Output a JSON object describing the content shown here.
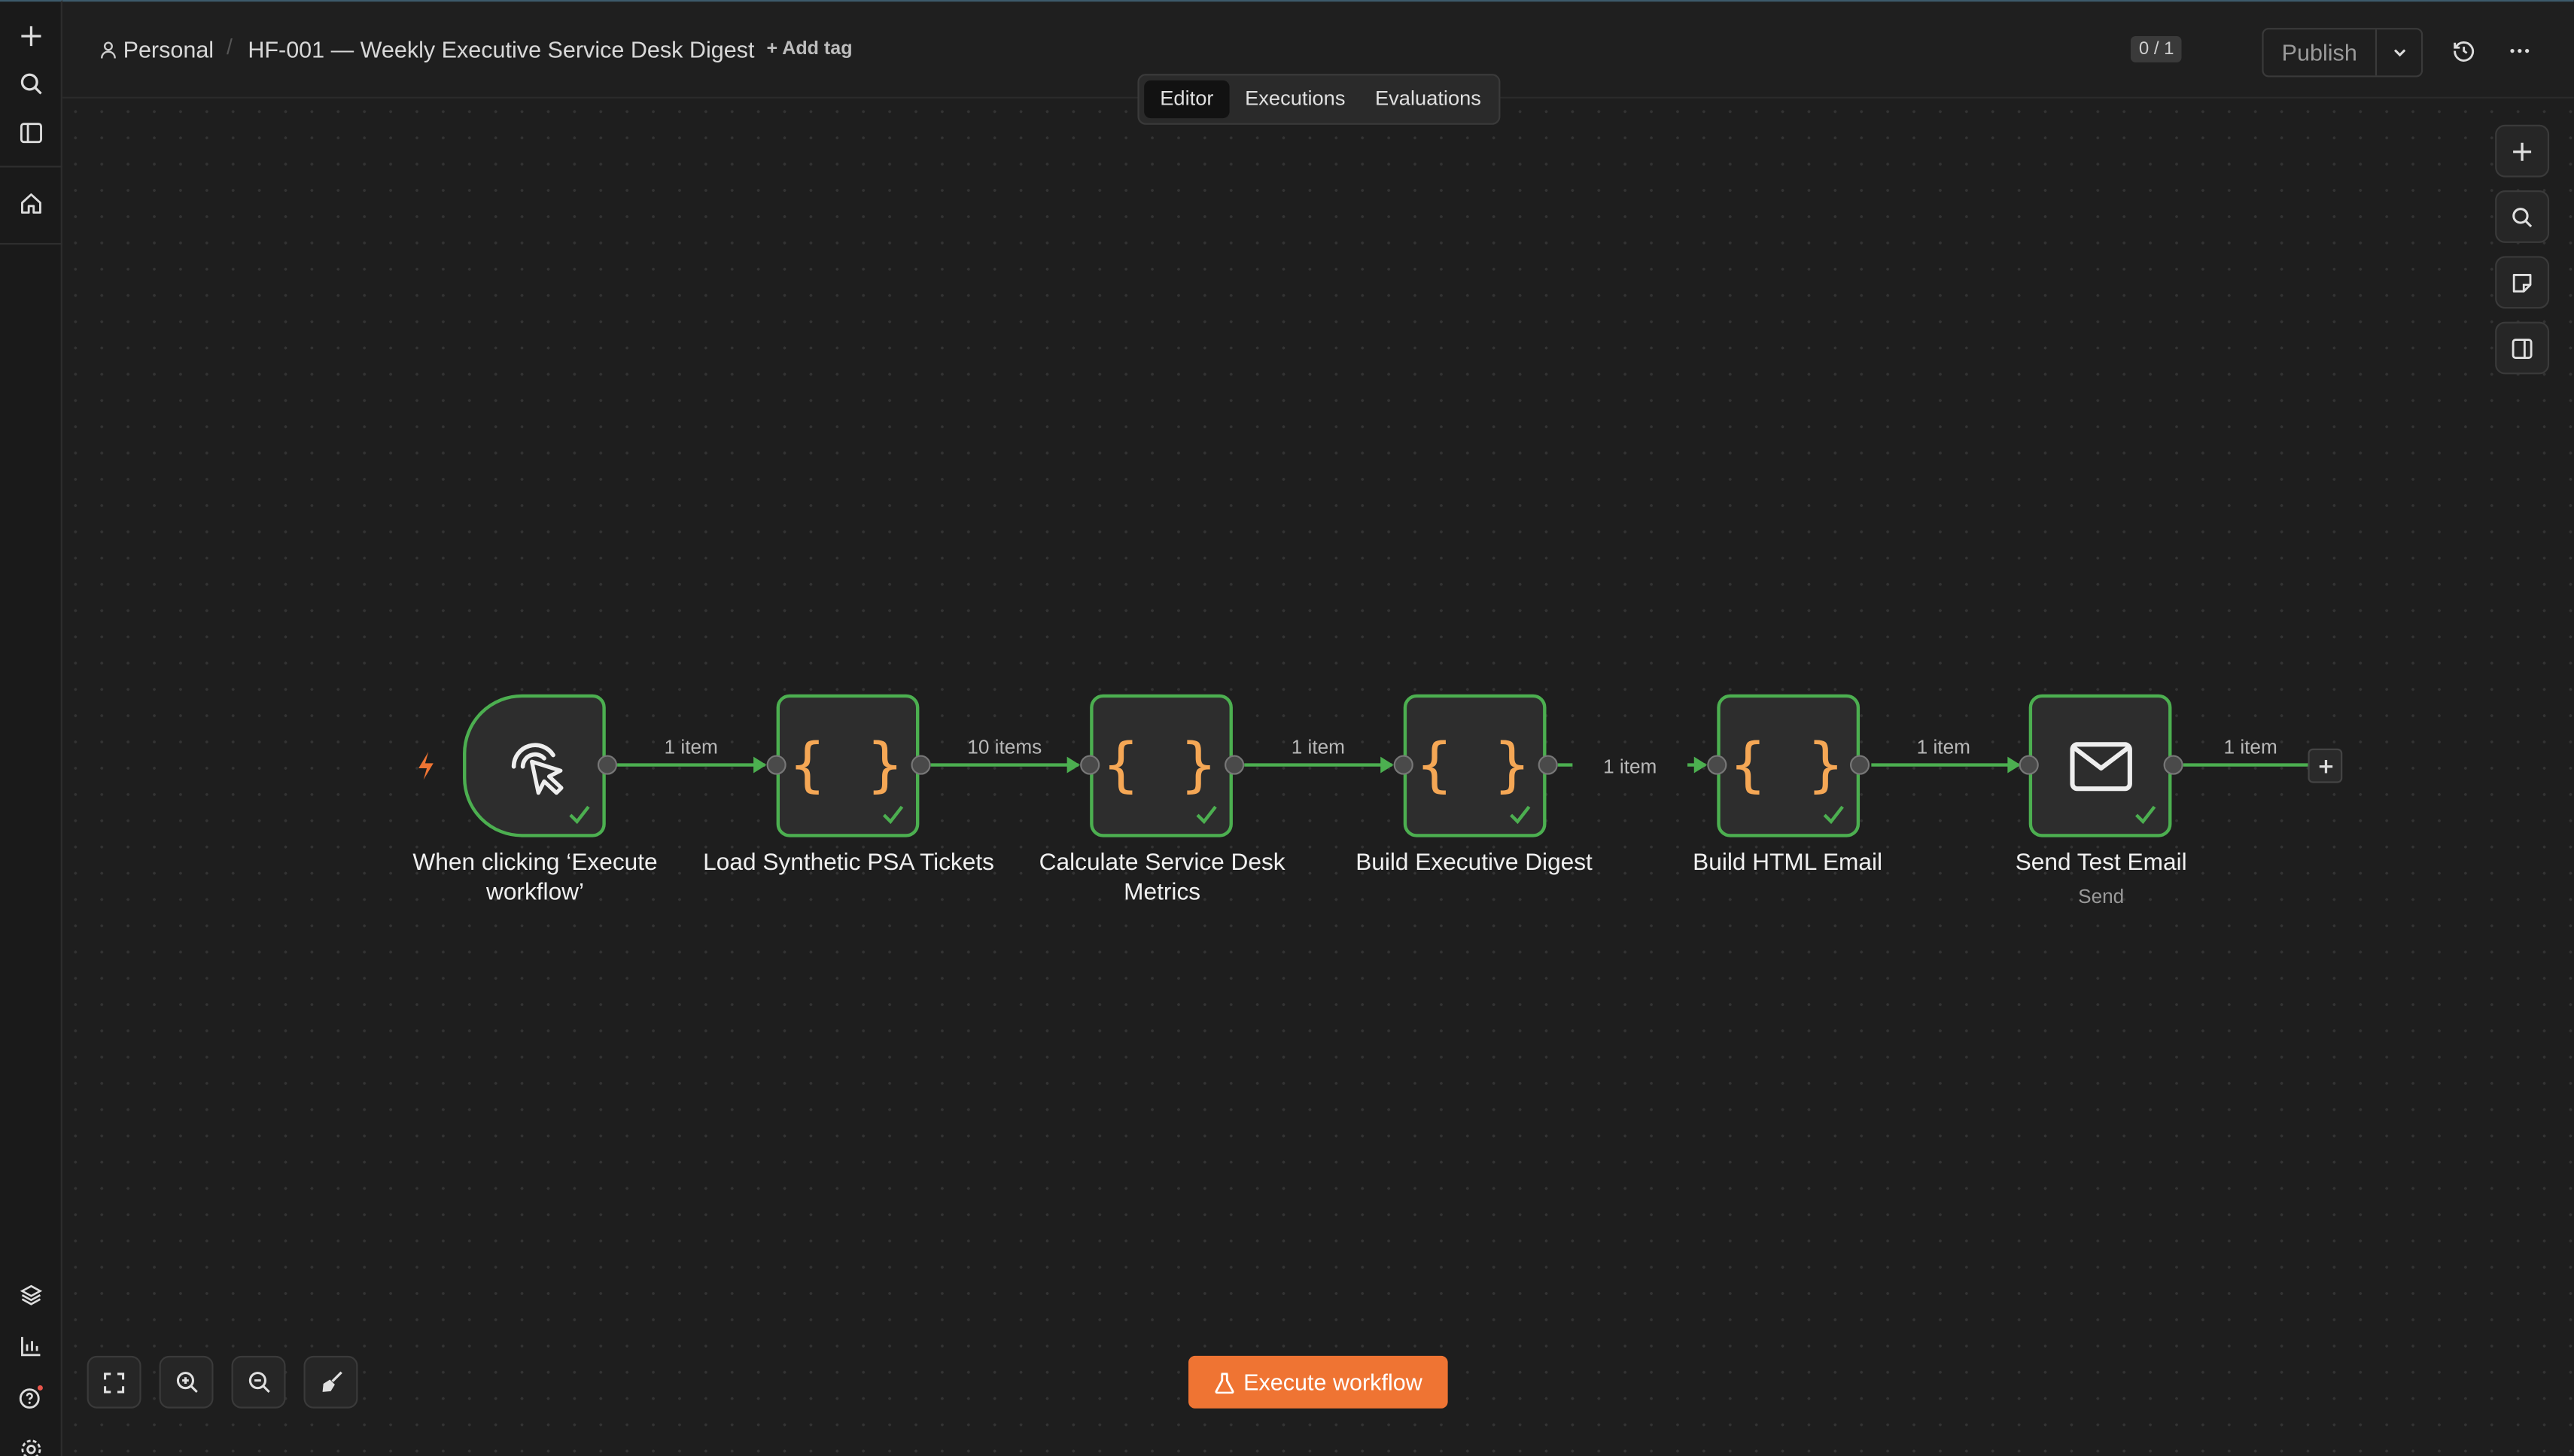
{
  "sidebar": {
    "icons": [
      "plus-icon",
      "search-icon",
      "panel-icon",
      "home-icon",
      "layers-icon",
      "chart-icon",
      "help-icon",
      "settings-icon"
    ]
  },
  "header": {
    "project": "Personal",
    "workflow_name": "HF-001 — Weekly Executive Service Desk Digest",
    "add_tag": "+ Add tag",
    "counter": "0 / 1",
    "publish": "Publish"
  },
  "tabs": [
    {
      "label": "Editor",
      "active": true
    },
    {
      "label": "Executions",
      "active": false
    },
    {
      "label": "Evaluations",
      "active": false
    }
  ],
  "nodes": [
    {
      "label": "When clicking ‘Execute workflow’",
      "icon": "cursor-click-icon",
      "status": "success"
    },
    {
      "label": "Load Synthetic PSA Tickets",
      "icon": "code-braces-icon",
      "status": "success"
    },
    {
      "label": "Calculate Service Desk Metrics",
      "icon": "code-braces-icon",
      "status": "success"
    },
    {
      "label": "Build Executive Digest",
      "icon": "code-braces-icon",
      "status": "success"
    },
    {
      "label": "Build HTML Email",
      "icon": "code-braces-icon",
      "status": "success"
    },
    {
      "label": "Send Test Email",
      "sublabel": "Send",
      "icon": "envelope-icon",
      "status": "success"
    }
  ],
  "edges": [
    {
      "label": "1 item"
    },
    {
      "label": "10 items"
    },
    {
      "label": "1 item"
    },
    {
      "label": "1 item"
    },
    {
      "label": "1 item"
    },
    {
      "label": "1 item"
    }
  ],
  "execute_button": {
    "label": "Execute workflow"
  },
  "colors": {
    "accent": "#ef7433",
    "success": "#4caf50",
    "code": "#f5a755"
  }
}
